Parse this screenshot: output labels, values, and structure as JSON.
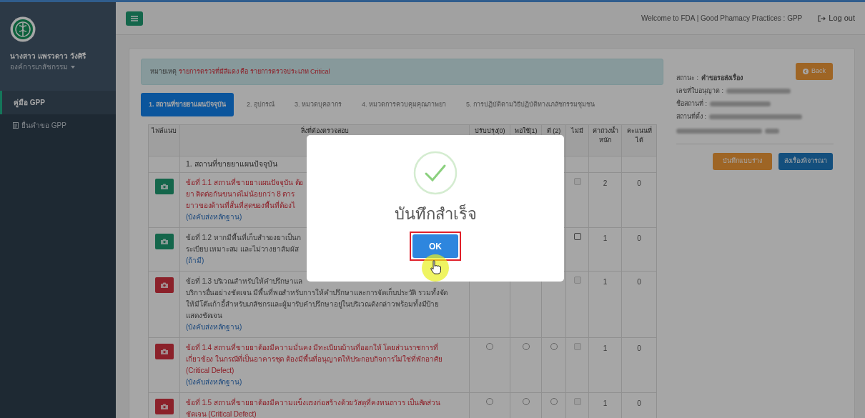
{
  "sidebar": {
    "user_name": "นางสาว แพรวดาว วังศิรี",
    "org": "องค์การเภสัชกรรม",
    "menu": [
      {
        "label": "คู่มือ GPP",
        "selected": true,
        "icon": false
      },
      {
        "label": "ยื่นคำขอ GPP",
        "selected": false,
        "icon": true
      }
    ]
  },
  "topbar": {
    "welcome": "Welcome to FDA | Good Phamacy Practices : GPP",
    "logout": "Log out"
  },
  "note": {
    "label": "หมายเหตุ",
    "text": "รายการตรวจที่มีสีแดง คือ รายการตรวจประเภท Critical"
  },
  "tabs": [
    {
      "label": "1. สถานที่ขายยาแผนปัจจุบัน",
      "selected": true
    },
    {
      "label": "2. อุปกรณ์",
      "selected": false
    },
    {
      "label": "3. หมวดบุคลากร",
      "selected": false
    },
    {
      "label": "4. หมวดการควบคุมคุณภาพยา",
      "selected": false
    },
    {
      "label": "5. การปฏิบัติตามวิธีปฏิบัติทางเภสัชกรรมชุมชน",
      "selected": false
    }
  ],
  "table": {
    "columns": [
      "ไฟล์แนบ",
      "สิ่งที่ต้องตรวจสอบ",
      "ปรับปรุง(0)",
      "พอใช้(1)",
      "ดี (2)",
      "ไม่มี",
      "ค่าถ่วงน้ำหนัก",
      "คะแนนที่ได้"
    ],
    "rows": [
      {
        "kind": "section",
        "text": "1. สถานที่ขายยาแผนปัจจุบัน"
      },
      {
        "kind": "item",
        "uploaded": true,
        "critical": true,
        "lines": [
          "ข้อที่ 1.1 สถานที่ขายยาแผนปัจจุบัน ต้อ",
          "ยา ติดต่อกันขนาดไม่น้อยกว่า 8 ตาร",
          "ยาวของด้านที่สั้นที่สุดของพื้นที่ต้องไ"
        ],
        "note": "(บังคับส่งหลักฐาน)",
        "na": {
          "checked": false,
          "disabled": true
        },
        "weight": "2",
        "score": "0"
      },
      {
        "kind": "item",
        "uploaded": true,
        "critical": false,
        "lines": [
          "ข้อที่ 1.2 หากมีพื้นที่เก็บสำรองยาเป็นก",
          "ระเบียบ เหมาะสม และไม่วางยาสัมผัส"
        ],
        "note": "(ถ้ามี)",
        "na": {
          "checked": false,
          "disabled": false
        },
        "weight": "1",
        "score": "0"
      },
      {
        "kind": "item",
        "uploaded": false,
        "critical": false,
        "lines": [
          "ข้อที่ 1.3 บริเวณสำหรับให้คำปรึกษาแล",
          "บริการอื่นอย่างชัดเจน มีพื้นที่พอสำหรับการให้คำปรึกษาและการจัดเก็บประวัติ รวมทั้งจัด",
          "ให้มีโต๊ะเก้าอี้สำหรับเภสัชกรและผู้มารับคำปรึกษาอยู่ในบริเวณดังกล่าวพร้อมทั้งมีป้าย",
          "แสดงชัดเจน"
        ],
        "note": "(บังคับส่งหลักฐาน)",
        "na": {
          "checked": false,
          "disabled": true
        },
        "weight": "1",
        "score": "0"
      },
      {
        "kind": "item",
        "uploaded": false,
        "critical": true,
        "lines": [
          "ข้อที่ 1.4 สถานที่ขายยาต้องมีความมั่นคง มีทะเบียนบ้านที่ออกให้ โดยส่วนราชการที่",
          "เกี่ยวข้อง ในกรณีที่เป็นอาคารชุด ต้องมีพื้นที่อนุญาตให้ประกอบกิจการไม่ใช่ที่พักอาศัย",
          "(Critical Defect)"
        ],
        "note": "(บังคับส่งหลักฐาน)",
        "ratings": [
          {
            "selected": false
          },
          {
            "selected": false
          },
          {
            "selected": false
          }
        ],
        "na": {
          "checked": false,
          "disabled": true
        },
        "weight": "1",
        "score": "0"
      },
      {
        "kind": "item",
        "uploaded": false,
        "critical": true,
        "lines": [
          "ข้อที่ 1.5 สถานที่ขายยาต้องมีความแข็งแรงก่อสร้างด้วยวัสดุที่คงทนถาวร เป็นสัดส่วน",
          "ชัดเจน (Critical Defect)"
        ],
        "ratings": [
          {
            "selected": false
          },
          {
            "selected": false
          },
          {
            "selected": false
          }
        ],
        "na": {
          "checked": false,
          "disabled": true
        },
        "weight": "1",
        "score": "0"
      }
    ]
  },
  "details": {
    "back": "Back",
    "fields": [
      {
        "label": "สถานะ :",
        "value": "คำขอรอส่งเรื่อง"
      },
      {
        "label": "เลขที่ใบอนุญาต :"
      },
      {
        "label": "ชื่อสถานที่ :"
      },
      {
        "label": "สถานที่ตั้ง :"
      }
    ],
    "save_draft": "บันทึกแบบร่าง",
    "submit": "ส่งเรื่องพิจารณา"
  },
  "modal": {
    "title": "บันทึกสำเร็จ",
    "ok": "OK"
  }
}
